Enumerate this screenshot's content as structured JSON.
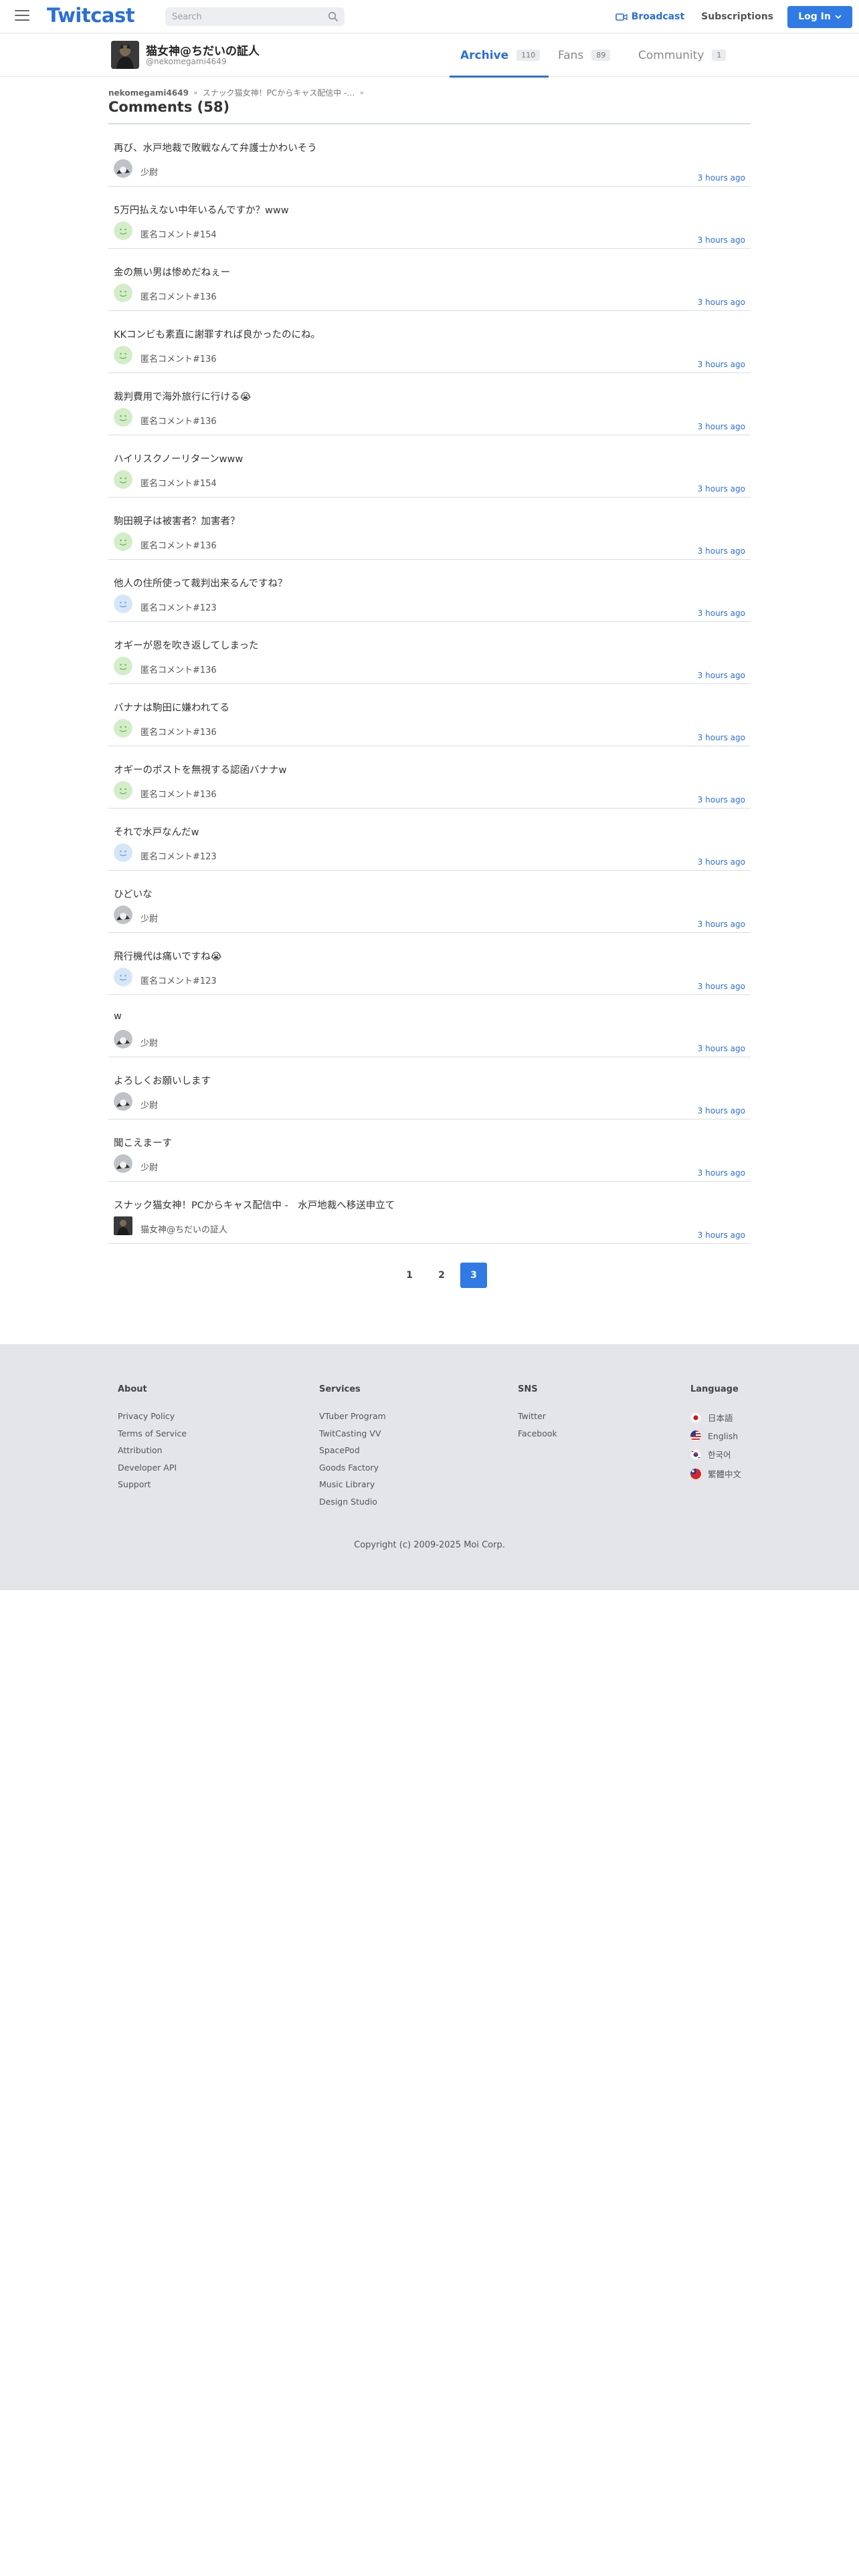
{
  "header": {
    "logo": "Twitcast",
    "search_placeholder": "Search",
    "broadcast": "Broadcast",
    "subscriptions": "Subscriptions",
    "login": "Log In"
  },
  "profile": {
    "name": "猫女神@ちだいの証人",
    "handle": "@nekomegami4649",
    "tabs": [
      {
        "label": "Archive",
        "count": "110"
      },
      {
        "label": "Fans",
        "count": "89"
      },
      {
        "label": "Community",
        "count": "1"
      }
    ]
  },
  "breadcrumb": {
    "user": "nekomegami4649",
    "movie": "スナック猫女神！PCからキャス配信中 -…"
  },
  "page_title": "Comments (58)",
  "comments": [
    {
      "text": "再び、水戸地裁で敗戦なんて弁護士かわいそう",
      "author": "少尉",
      "time": "3 hours ago",
      "avatar": "gray"
    },
    {
      "text": "5万円払えない中年いるんですか？www",
      "author": "匿名コメント#154",
      "time": "3 hours ago",
      "avatar": "green"
    },
    {
      "text": "金の無い男は惨めだねぇー",
      "author": "匿名コメント#136",
      "time": "3 hours ago",
      "avatar": "green"
    },
    {
      "text": "KKコンビも素直に謝罪すれば良かったのにね。",
      "author": "匿名コメント#136",
      "time": "3 hours ago",
      "avatar": "green"
    },
    {
      "text": "裁判費用で海外旅行に行ける😭",
      "author": "匿名コメント#136",
      "time": "3 hours ago",
      "avatar": "green"
    },
    {
      "text": "ハイリスクノーリターンwww",
      "author": "匿名コメント#154",
      "time": "3 hours ago",
      "avatar": "green"
    },
    {
      "text": "駒田親子は被害者？加害者？",
      "author": "匿名コメント#136",
      "time": "3 hours ago",
      "avatar": "green"
    },
    {
      "text": "他人の住所使って裁判出来るんですね？",
      "author": "匿名コメント#123",
      "time": "3 hours ago",
      "avatar": "blue"
    },
    {
      "text": "オギーが恩を吹き返してしまった",
      "author": "匿名コメント#136",
      "time": "3 hours ago",
      "avatar": "green"
    },
    {
      "text": "バナナは駒田に嫌われてる",
      "author": "匿名コメント#136",
      "time": "3 hours ago",
      "avatar": "green"
    },
    {
      "text": "オギーのポストを無視する認函バナナw",
      "author": "匿名コメント#136",
      "time": "3 hours ago",
      "avatar": "green"
    },
    {
      "text": "それで水戸なんだw",
      "author": "匿名コメント#123",
      "time": "3 hours ago",
      "avatar": "blue"
    },
    {
      "text": "ひどいな",
      "author": "少尉",
      "time": "3 hours ago",
      "avatar": "gray"
    },
    {
      "text": "飛行機代は痛いですね😭",
      "author": "匿名コメント#123",
      "time": "3 hours ago",
      "avatar": "blue"
    },
    {
      "text": "w",
      "author": "少尉",
      "time": "3 hours ago",
      "avatar": "gray"
    },
    {
      "text": "よろしくお願いします",
      "author": "少尉",
      "time": "3 hours ago",
      "avatar": "gray"
    },
    {
      "text": "聞こえまーす",
      "author": "少尉",
      "time": "3 hours ago",
      "avatar": "gray"
    },
    {
      "text": "スナック猫女神！PCからキャス配信中 -　水戸地裁へ移送申立て",
      "author": "猫女神@ちだいの証人",
      "time": "3 hours ago",
      "avatar": "owner"
    }
  ],
  "pagination": {
    "pages": [
      "1",
      "2",
      "3"
    ],
    "current": "3"
  },
  "footer": {
    "about": {
      "title": "About",
      "links": [
        "Privacy Policy",
        "Terms of Service",
        "Attribution",
        "Developer API",
        "Support"
      ]
    },
    "services": {
      "title": "Services",
      "links": [
        "VTuber Program",
        "TwitCasting VV",
        "SpacePod",
        "Goods Factory",
        "Music Library",
        "Design Studio"
      ]
    },
    "sns": {
      "title": "SNS",
      "links": [
        "Twitter",
        "Facebook"
      ]
    },
    "language": {
      "title": "Language",
      "links": [
        "日本語",
        "English",
        "한국어",
        "繁體中文"
      ]
    },
    "copyright": "Copyright (c) 2009-2025 Moi Corp."
  },
  "colors": {
    "accent": "#2b6fd6",
    "button": "#2f7ae5",
    "footer_bg": "#e3e5e8"
  },
  "icons": {
    "menu": "hamburger-icon",
    "search": "search-icon",
    "broadcast": "camera-icon"
  }
}
